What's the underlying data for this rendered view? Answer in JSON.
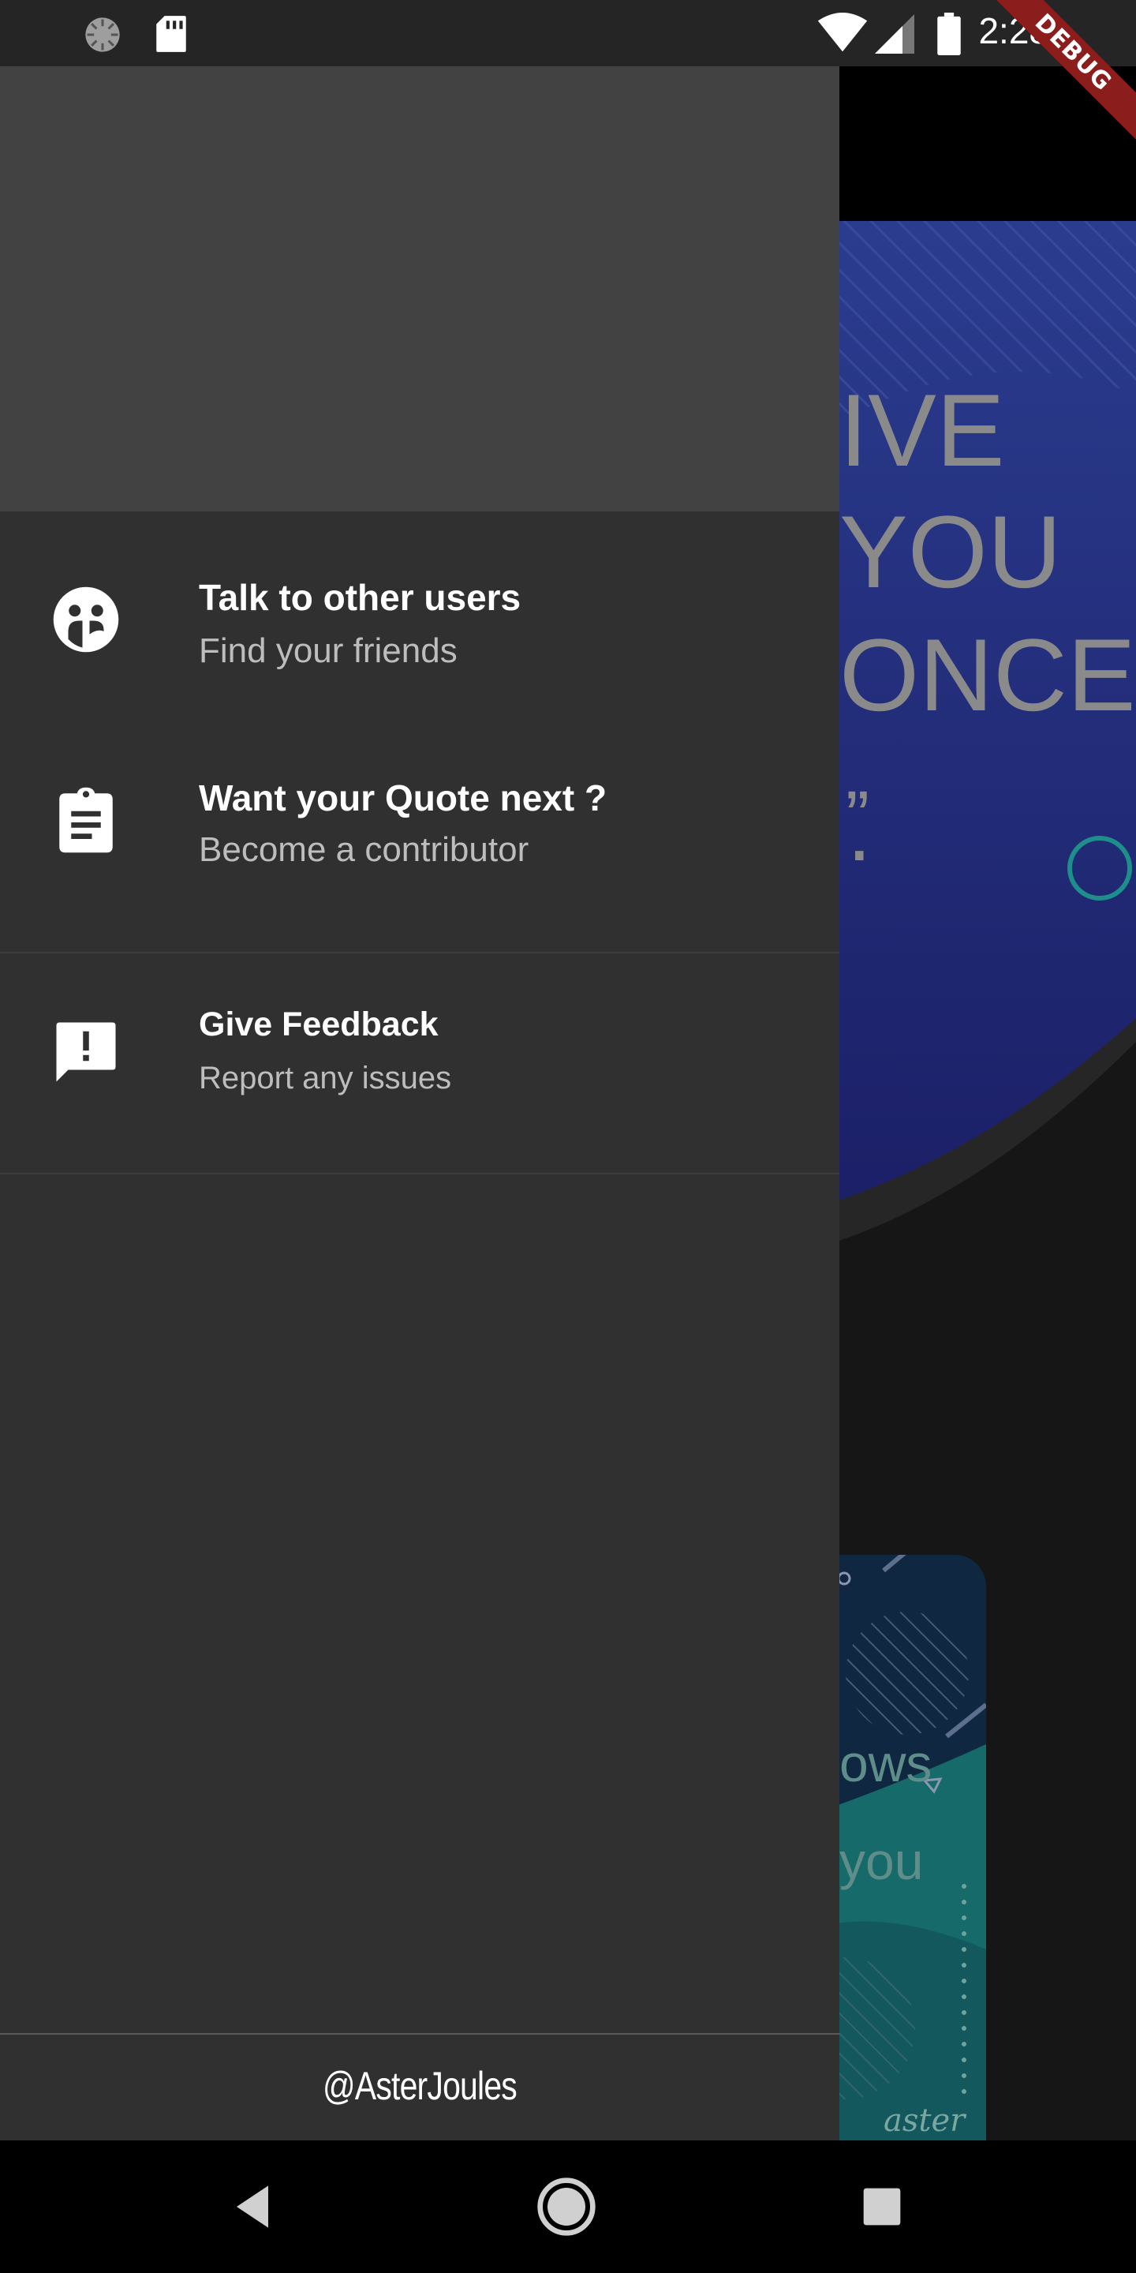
{
  "status_bar": {
    "time": "2:28",
    "debug_label": "DEBUG",
    "left_icons": [
      "loading-spinner-icon",
      "sd-card-icon"
    ],
    "right_icons": [
      "wifi-icon",
      "signal-icon",
      "battery-icon"
    ]
  },
  "background_app": {
    "hero_lines": [
      "IVE",
      "YOU",
      "ONCE",
      "."
    ],
    "card_lines": [
      "ows",
      "you"
    ],
    "card_signature": "aster"
  },
  "drawer": {
    "items": [
      {
        "title": "Talk to other users",
        "subtitle": "Find your friends",
        "icon": "users-chat-icon"
      },
      {
        "title": "Want your Quote next ?",
        "subtitle": "Become a contributor",
        "icon": "clipboard-icon"
      },
      {
        "title": "Give Feedback",
        "subtitle": "Report any issues",
        "icon": "feedback-icon"
      }
    ],
    "footer": "@AsterJoules"
  },
  "nav_bar": {
    "buttons": [
      "back-icon",
      "home-icon",
      "recents-icon"
    ]
  },
  "colors": {
    "drawer_bg": "#303030",
    "drawer_header_bg": "#424242",
    "status_bar_bg": "#252525",
    "debug_ribbon": "#8b1d1d",
    "hero_blue": "#2a3a9e",
    "card_teal": "#1e6b6b"
  }
}
